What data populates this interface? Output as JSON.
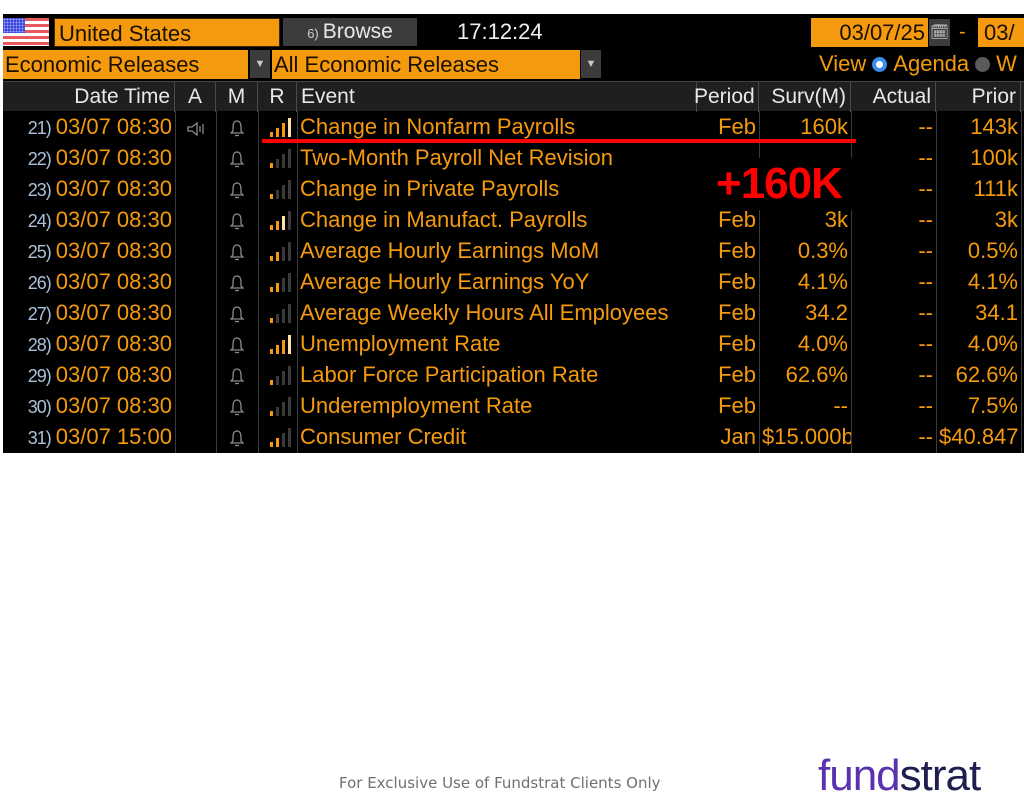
{
  "header": {
    "country": "United States",
    "browse_number": "6)",
    "browse_label": "Browse",
    "time": "17:12:24",
    "date_from": "03/07/25",
    "date_separator": "-",
    "date_to": "03/",
    "category_select": "Economic Releases",
    "subcategory_select": "All Economic Releases",
    "view_label": "View",
    "view_options": [
      {
        "label": "Agenda",
        "selected": true
      },
      {
        "label": "W",
        "selected": false
      }
    ]
  },
  "columns": {
    "datetime": "Date Time",
    "a": "A",
    "m": "M",
    "r": "R",
    "event": "Event",
    "period": "Period",
    "surv": "Surv(M)",
    "actual": "Actual",
    "prior": "Prior"
  },
  "rows": [
    {
      "num": "21)",
      "datetime": "03/07 08:30",
      "audio": true,
      "relevance": 4,
      "event": "Change in Nonfarm Payrolls",
      "period": "Feb",
      "surv": "160k",
      "actual": "--",
      "prior": "143k"
    },
    {
      "num": "22)",
      "datetime": "03/07 08:30",
      "audio": false,
      "relevance": 1,
      "event": "Two-Month Payroll Net Revision",
      "period": "",
      "surv": "",
      "actual": "--",
      "prior": "100k"
    },
    {
      "num": "23)",
      "datetime": "03/07 08:30",
      "audio": false,
      "relevance": 1,
      "event": "Change in Private Payrolls",
      "period": "",
      "surv": "",
      "actual": "--",
      "prior": "111k"
    },
    {
      "num": "24)",
      "datetime": "03/07 08:30",
      "audio": false,
      "relevance": 3,
      "event": "Change in Manufact. Payrolls",
      "period": "Feb",
      "surv": "3k",
      "actual": "--",
      "prior": "3k"
    },
    {
      "num": "25)",
      "datetime": "03/07 08:30",
      "audio": false,
      "relevance": 2,
      "event": "Average Hourly Earnings MoM",
      "period": "Feb",
      "surv": "0.3%",
      "actual": "--",
      "prior": "0.5%"
    },
    {
      "num": "26)",
      "datetime": "03/07 08:30",
      "audio": false,
      "relevance": 2,
      "event": "Average Hourly Earnings YoY",
      "period": "Feb",
      "surv": "4.1%",
      "actual": "--",
      "prior": "4.1%"
    },
    {
      "num": "27)",
      "datetime": "03/07 08:30",
      "audio": false,
      "relevance": 1,
      "event": "Average Weekly Hours All Employees",
      "period": "Feb",
      "surv": "34.2",
      "actual": "--",
      "prior": "34.1"
    },
    {
      "num": "28)",
      "datetime": "03/07 08:30",
      "audio": false,
      "relevance": 4,
      "event": "Unemployment Rate",
      "period": "Feb",
      "surv": "4.0%",
      "actual": "--",
      "prior": "4.0%"
    },
    {
      "num": "29)",
      "datetime": "03/07 08:30",
      "audio": false,
      "relevance": 1,
      "event": "Labor Force Participation Rate",
      "period": "Feb",
      "surv": "62.6%",
      "actual": "--",
      "prior": "62.6%"
    },
    {
      "num": "30)",
      "datetime": "03/07 08:30",
      "audio": false,
      "relevance": 1,
      "event": "Underemployment Rate",
      "period": "Feb",
      "surv": "--",
      "actual": "--",
      "prior": "7.5%"
    },
    {
      "num": "31)",
      "datetime": "03/07 15:00",
      "audio": false,
      "relevance": 2,
      "event": "Consumer Credit",
      "period": "Jan",
      "surv": "$15.000b",
      "actual": "--",
      "prior": "$40.847"
    }
  ],
  "annotation": {
    "label": "+160K",
    "color": "#ff0000"
  },
  "footer": {
    "disclaimer": "For Exclusive Use of Fundstrat Clients Only",
    "logo_part1": "fund",
    "logo_part2": "strat"
  },
  "colors": {
    "accent": "#f59a0e",
    "background": "#000000",
    "logo_purple": "#5932b0",
    "logo_navy": "#1e1f4f"
  }
}
